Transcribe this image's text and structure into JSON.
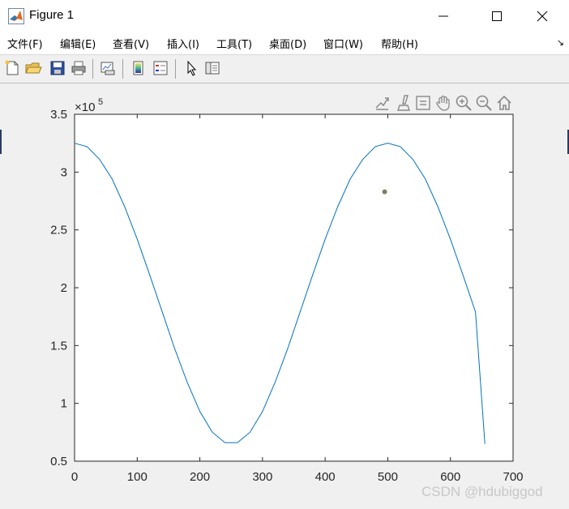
{
  "window": {
    "title": "Figure 1"
  },
  "menu": {
    "items": [
      "文件(F)",
      "编辑(E)",
      "查看(V)",
      "插入(I)",
      "工具(T)",
      "桌面(D)",
      "窗口(W)",
      "帮助(H)"
    ]
  },
  "toolbar": {
    "buttons": [
      "new-figure",
      "open-file",
      "save",
      "print",
      "link-plot",
      "insert-colorbar",
      "insert-legend",
      "edit-plot",
      "property-inspector"
    ]
  },
  "axes_toolbar": {
    "buttons": [
      "export",
      "brush",
      "data-tips",
      "pan",
      "zoom-in",
      "zoom-out",
      "restore-view"
    ]
  },
  "chart_data": {
    "type": "line",
    "title": "",
    "xlabel": "",
    "ylabel": "",
    "xlim": [
      0,
      700
    ],
    "ylim": [
      0.5,
      3.5
    ],
    "y_multiplier": "×10",
    "y_exponent": "5",
    "xticks": [
      "0",
      "100",
      "200",
      "300",
      "400",
      "500",
      "600",
      "700"
    ],
    "yticks": [
      "0.5",
      "1",
      "1.5",
      "2",
      "2.5",
      "3",
      "3.5"
    ],
    "series": [
      {
        "color": "#0072bd",
        "x": [
          0,
          20,
          40,
          60,
          80,
          100,
          120,
          140,
          160,
          180,
          200,
          220,
          240,
          260,
          280,
          300,
          320,
          340,
          360,
          380,
          400,
          420,
          440,
          460,
          480,
          500,
          520,
          540,
          560,
          580,
          600,
          620,
          640,
          655
        ],
        "y": [
          3.25,
          3.22,
          3.11,
          2.94,
          2.7,
          2.42,
          2.11,
          1.79,
          1.47,
          1.18,
          0.93,
          0.75,
          0.66,
          0.66,
          0.75,
          0.93,
          1.18,
          1.47,
          1.79,
          2.11,
          2.42,
          2.7,
          2.94,
          3.11,
          3.22,
          3.25,
          3.22,
          3.11,
          2.94,
          2.7,
          2.42,
          2.11,
          1.79,
          0.65
        ]
      }
    ],
    "marker": {
      "x": 495,
      "y": 2.83,
      "color": "#7f7f5f"
    },
    "grid": false
  },
  "watermark": "CSDN @hdubiggod"
}
